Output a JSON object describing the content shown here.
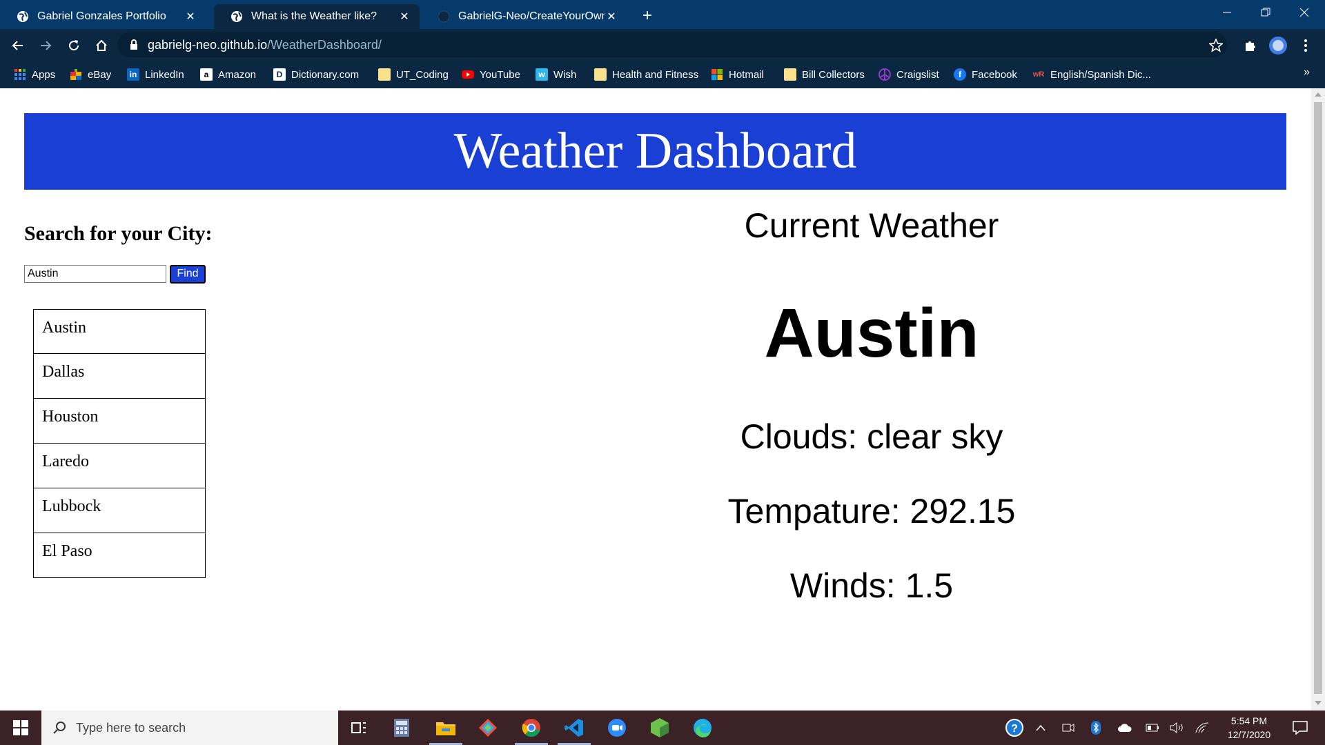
{
  "browser": {
    "tabs": [
      {
        "title": "Gabriel Gonzales Portfolio",
        "active": false
      },
      {
        "title": "What is the Weather like?",
        "active": true
      },
      {
        "title": "GabrielG-Neo/CreateYourOwnPa",
        "active": false
      }
    ],
    "url_domain": "gabrielg-neo.github.io",
    "url_path": "/WeatherDashboard/",
    "bookmarks": [
      {
        "label": "Apps",
        "icon": "apps-grid-icon"
      },
      {
        "label": "eBay",
        "icon": "ebay-icon"
      },
      {
        "label": "LinkedIn",
        "icon": "linkedin-icon"
      },
      {
        "label": "Amazon",
        "icon": "amazon-icon"
      },
      {
        "label": "Dictionary.com",
        "icon": "dictionary-icon"
      },
      {
        "label": "UT_Coding",
        "icon": "folder-icon"
      },
      {
        "label": "YouTube",
        "icon": "youtube-icon"
      },
      {
        "label": "Wish",
        "icon": "wish-icon"
      },
      {
        "label": "Health and Fitness",
        "icon": "folder-icon"
      },
      {
        "label": "Hotmail",
        "icon": "microsoft-icon"
      },
      {
        "label": "Bill Collectors",
        "icon": "folder-icon"
      },
      {
        "label": "Craigslist",
        "icon": "craigslist-icon"
      },
      {
        "label": "Facebook",
        "icon": "facebook-icon"
      },
      {
        "label": "English/Spanish Dic...",
        "icon": "wordreference-icon"
      }
    ],
    "more_bookmarks": "»"
  },
  "page": {
    "header_title": "Weather Dashboard",
    "search_heading": "Search for your City:",
    "search_value": "Austin",
    "find_label": "Find",
    "cities": [
      "Austin",
      "Dallas",
      "Houston",
      "Laredo",
      "Lubbock",
      "El Paso"
    ],
    "current_title": "Current Weather",
    "current_city": "Austin",
    "clouds": "Clouds: clear sky",
    "temperature": "Tempature: 292.15",
    "winds": "Winds: 1.5"
  },
  "taskbar": {
    "search_placeholder": "Type here to search",
    "time": "5:54 PM",
    "date": "12/7/2020"
  },
  "colors": {
    "header_blue": "#1a3fd4",
    "chrome_dark": "#0b2742",
    "tabstrip": "#063a6b",
    "taskbar": "#3b2226"
  }
}
